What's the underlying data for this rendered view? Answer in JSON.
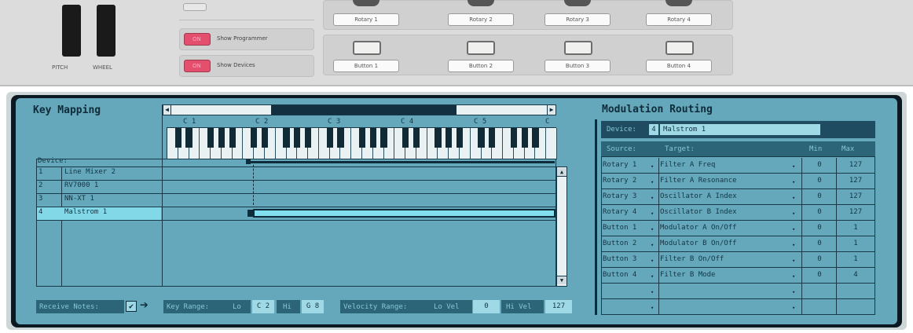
{
  "wheels": {
    "pitch_label": "PITCH",
    "wheel_label": "WHEEL"
  },
  "toggles": {
    "show_programmer": "Show Programmer",
    "show_devices": "Show Devices",
    "led_text": "ON"
  },
  "rotaries": [
    "Rotary 1",
    "Rotary 2",
    "Rotary 3",
    "Rotary 4"
  ],
  "buttons": [
    "Button 1",
    "Button 2",
    "Button 3",
    "Button 4"
  ],
  "key_mapping": {
    "title": "Key Mapping",
    "octaves": [
      "C 1",
      "C 2",
      "C 3",
      "C 4",
      "C 5",
      "C"
    ],
    "device_label": "Device:",
    "devices": [
      {
        "num": "1",
        "name": "Line Mixer 2"
      },
      {
        "num": "2",
        "name": "RV7000 1"
      },
      {
        "num": "3",
        "name": "NN-XT 1"
      },
      {
        "num": "4",
        "name": "Malstrom 1"
      }
    ],
    "selected_index": 3
  },
  "modulation": {
    "title": "Modulation Routing",
    "device_label": "Device:",
    "device_num": "4",
    "device_name": "Malstrom 1",
    "headers": [
      "Source:",
      "Target:",
      "Min",
      "Max"
    ],
    "rows": [
      {
        "source": "Rotary 1",
        "target": "Filter A Freq",
        "min": "0",
        "max": "127"
      },
      {
        "source": "Rotary 2",
        "target": "Filter A Resonance",
        "min": "0",
        "max": "127"
      },
      {
        "source": "Rotary 3",
        "target": "Oscillator A Index",
        "min": "0",
        "max": "127"
      },
      {
        "source": "Rotary 4",
        "target": "Oscillator B Index",
        "min": "0",
        "max": "127"
      },
      {
        "source": "Button 1",
        "target": "Modulator A On/Off",
        "min": "0",
        "max": "1"
      },
      {
        "source": "Button 2",
        "target": "Modulator B On/Off",
        "min": "0",
        "max": "1"
      },
      {
        "source": "Button 3",
        "target": "Filter B On/Off",
        "min": "0",
        "max": "1"
      },
      {
        "source": "Button 4",
        "target": "Filter B Mode",
        "min": "0",
        "max": "4"
      },
      {
        "source": "",
        "target": "",
        "min": "",
        "max": ""
      },
      {
        "source": "",
        "target": "",
        "min": "",
        "max": ""
      }
    ]
  },
  "footer": {
    "receive_notes": "Receive Notes:",
    "key_range": "Key Range:",
    "lo": "Lo",
    "lo_val": "C 2",
    "hi": "Hi",
    "hi_val": "G 8",
    "velocity_range": "Velocity Range:",
    "lo_vel": "Lo Vel",
    "lo_vel_val": "0",
    "hi_vel": "Hi Vel",
    "hi_vel_val": "127"
  },
  "colors": {
    "screen": "#66a8bb",
    "frame": "#0b1a22",
    "led": "#e44f6e",
    "highlight": "#82d8e6"
  }
}
